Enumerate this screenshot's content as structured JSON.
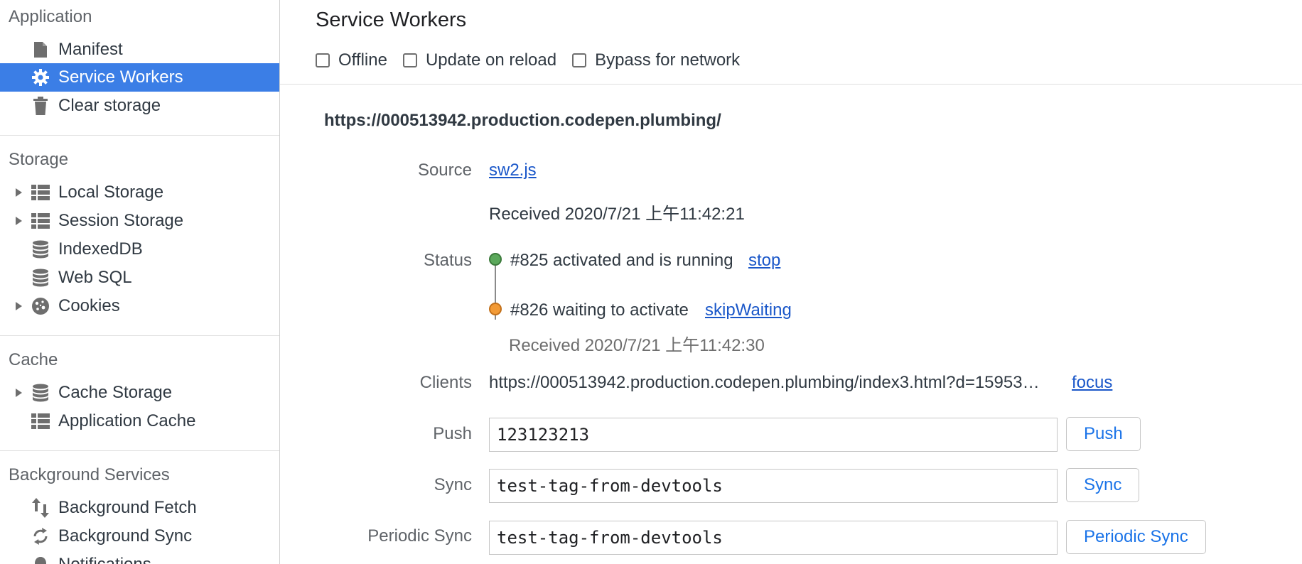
{
  "sidebar": {
    "application": {
      "header": "Application",
      "items": [
        {
          "label": "Manifest",
          "icon": "document-icon"
        },
        {
          "label": "Service Workers",
          "icon": "gear-icon",
          "selected": true
        },
        {
          "label": "Clear storage",
          "icon": "trash-icon"
        }
      ]
    },
    "storage": {
      "header": "Storage",
      "items": [
        {
          "label": "Local Storage",
          "icon": "grid-icon",
          "expandable": true
        },
        {
          "label": "Session Storage",
          "icon": "grid-icon",
          "expandable": true
        },
        {
          "label": "IndexedDB",
          "icon": "database-icon"
        },
        {
          "label": "Web SQL",
          "icon": "database-icon"
        },
        {
          "label": "Cookies",
          "icon": "cookie-icon",
          "expandable": true
        }
      ]
    },
    "cache": {
      "header": "Cache",
      "items": [
        {
          "label": "Cache Storage",
          "icon": "database-icon",
          "expandable": true
        },
        {
          "label": "Application Cache",
          "icon": "grid-icon"
        }
      ]
    },
    "background_services": {
      "header": "Background Services",
      "items": [
        {
          "label": "Background Fetch",
          "icon": "up-down-arrows-icon"
        },
        {
          "label": "Background Sync",
          "icon": "sync-icon"
        },
        {
          "label": "Notifications",
          "icon": "bell-icon"
        }
      ]
    }
  },
  "main": {
    "title": "Service Workers",
    "toolbar": {
      "offline": "Offline",
      "update_on_reload": "Update on reload",
      "bypass_for_network": "Bypass for network"
    },
    "origin": "https://000513942.production.codepen.plumbing/",
    "source": {
      "label": "Source",
      "link": "sw2.js",
      "received": "Received 2020/7/21 上午11:42:21"
    },
    "status": {
      "label": "Status",
      "active": {
        "text": "#825 activated and is running",
        "action": "stop"
      },
      "waiting": {
        "text": "#826 waiting to activate",
        "action": "skipWaiting",
        "received": "Received 2020/7/21 上午11:42:30"
      }
    },
    "clients": {
      "label": "Clients",
      "url": "https://000513942.production.codepen.plumbing/index3.html?d=15953…",
      "action": "focus"
    },
    "push": {
      "label": "Push",
      "value": "123123213",
      "button": "Push"
    },
    "sync": {
      "label": "Sync",
      "value": "test-tag-from-devtools",
      "button": "Sync"
    },
    "periodic_sync": {
      "label": "Periodic Sync",
      "value": "test-tag-from-devtools",
      "button": "Periodic Sync"
    }
  },
  "colors": {
    "selected_bg": "#3b7ee6",
    "link": "#1a57c9",
    "button_text": "#1a73e8",
    "status_active": "#5ba85b",
    "status_waiting": "#f29a36"
  }
}
